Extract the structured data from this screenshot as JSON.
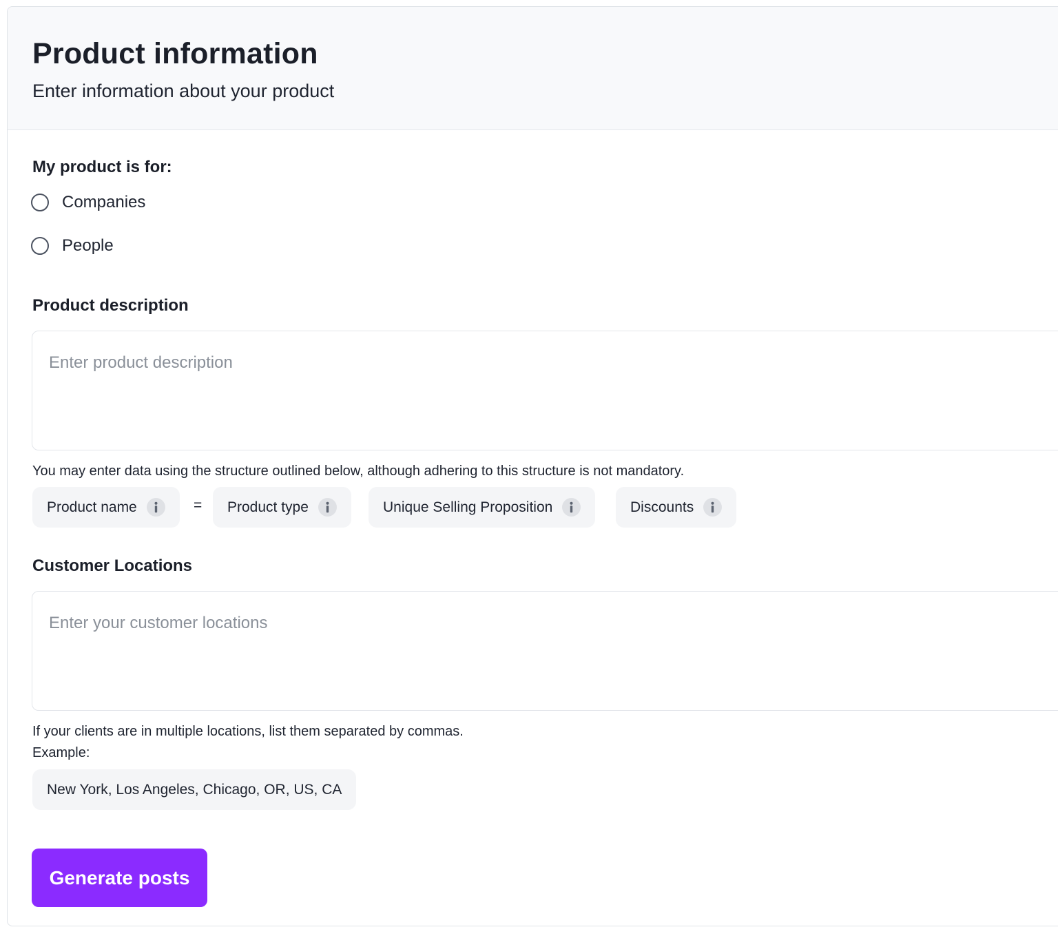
{
  "header": {
    "title": "Product information",
    "subtitle": "Enter information about your product"
  },
  "audience": {
    "label": "My product is for:",
    "options": [
      {
        "label": "Companies",
        "selected": false
      },
      {
        "label": "People",
        "selected": false
      }
    ]
  },
  "description": {
    "label": "Product description",
    "placeholder": "Enter product description",
    "value": "",
    "hint": "You may enter data using the structure outlined below, although adhering to this structure is not mandatory.",
    "structure": {
      "chips": [
        "Product name",
        "Product type",
        "Unique Selling Proposition",
        "Discounts"
      ],
      "separator": "="
    }
  },
  "locations": {
    "label": "Customer Locations",
    "placeholder": "Enter your customer locations",
    "value": "",
    "hint": "If your clients are in multiple locations, list them separated by commas.",
    "example_label": "Example:",
    "example_value": "New York, Los Angeles, Chicago, OR, US, CA"
  },
  "actions": {
    "generate_label": "Generate posts"
  },
  "icons": {
    "info": "info-icon"
  },
  "colors": {
    "accent": "#8b2bff",
    "header_bg": "#f8f9fb",
    "chip_bg": "#f4f5f7"
  }
}
